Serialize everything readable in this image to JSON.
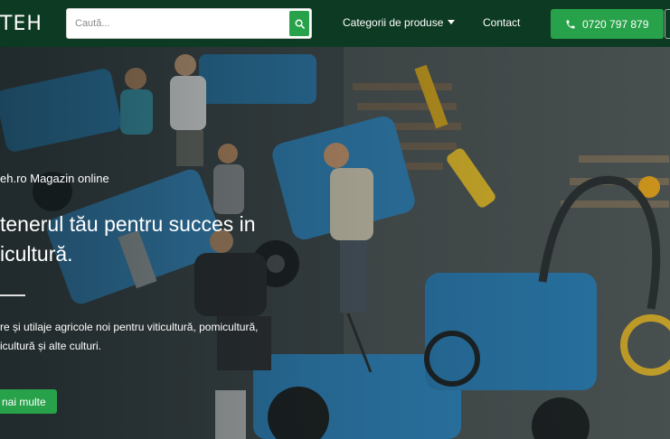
{
  "header": {
    "logo": "TEH",
    "search": {
      "placeholder": "Caută..."
    },
    "nav": {
      "categories_label": "Categorii de produse",
      "contact_label": "Contact"
    },
    "phone": "0720 797 879"
  },
  "hero": {
    "tagline": "eh.ro Magazin online",
    "headline_line1": "tenerul tău pentru succes in",
    "headline_line2": "icultură.",
    "desc_line1": "re și utilaje agricole noi pentru viticultură, pomicultură,",
    "desc_line2": "icultură și alte culturi.",
    "cta_label": "nai multe"
  },
  "colors": {
    "header_bg": "#0d3a22",
    "accent": "#28a24a",
    "tractor_blue": "#2f7fb0"
  }
}
